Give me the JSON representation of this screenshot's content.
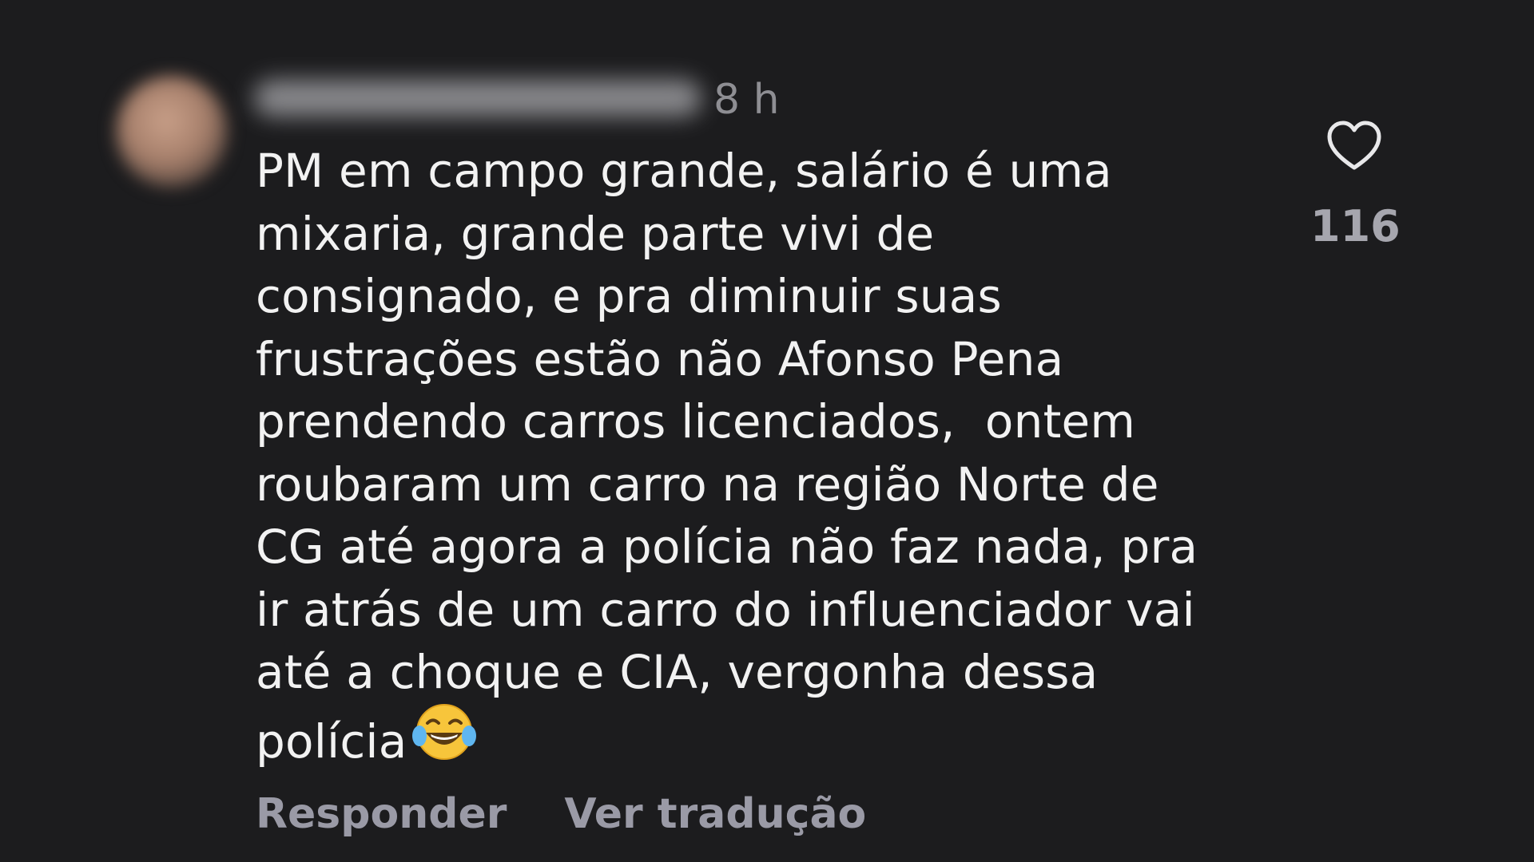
{
  "comment": {
    "timestamp": "8 h",
    "text": "PM em campo grande, salário é uma\nmixaria, grande parte vivi de\nconsignado, e pra diminuir suas\nfrustrações estão não Afonso Pena\nprendendo carros licenciados,  ontem\nroubaram um carro na região Norte de\nCG até agora a polícia não faz nada, pra\nir atrás de um carro do influenciador vai\naté a choque e CIA, vergonha dessa\npolícia",
    "emoji_icon": "face-with-tears-of-joy-icon",
    "like_icon": "heart-outline-icon",
    "like_count": "116",
    "actions": {
      "reply_label": "Responder",
      "translate_label": "Ver tradução"
    }
  },
  "colors": {
    "background": "#1c1c1e",
    "text": "#f2f2f2",
    "muted": "#8e8e93",
    "action": "#9a9aa6"
  }
}
